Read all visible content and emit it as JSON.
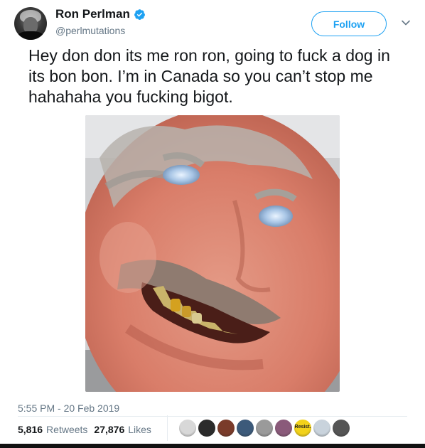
{
  "tweet": {
    "author": {
      "display_name": "Ron Perlman",
      "handle": "@perlmutations",
      "verified": true
    },
    "follow_label": "Follow",
    "text": "Hey don don its me ron ron, going to fuck a dog in its bon bon. I’m in Canada so you can’t stop me hahahaha you fucking bigot.",
    "timestamp": "5:55 PM - 20 Feb 2019",
    "retweets": {
      "count": "5,816",
      "label": "Retweets"
    },
    "likes": {
      "count": "27,876",
      "label": "Likes"
    },
    "liker_avatars": [
      {
        "icon": "liker-avatar-1",
        "color": "#d8d8d8",
        "text": ""
      },
      {
        "icon": "liker-avatar-2",
        "color": "#2b2b2b",
        "text": ""
      },
      {
        "icon": "liker-avatar-3",
        "color": "#7a3b2a",
        "text": ""
      },
      {
        "icon": "liker-avatar-4",
        "color": "#3c5a7a",
        "text": ""
      },
      {
        "icon": "liker-avatar-5",
        "color": "#9a9a9a",
        "text": ""
      },
      {
        "icon": "liker-avatar-6",
        "color": "#8a5a7a",
        "text": ""
      },
      {
        "icon": "liker-avatar-7",
        "color": "#f2d21a",
        "text": "Resist."
      },
      {
        "icon": "liker-avatar-8",
        "color": "#c9d3dc",
        "text": ""
      },
      {
        "icon": "liker-avatar-9",
        "color": "#555555",
        "text": ""
      }
    ]
  },
  "colors": {
    "accent": "#1da1f2",
    "muted": "#657786",
    "text": "#14171a"
  }
}
